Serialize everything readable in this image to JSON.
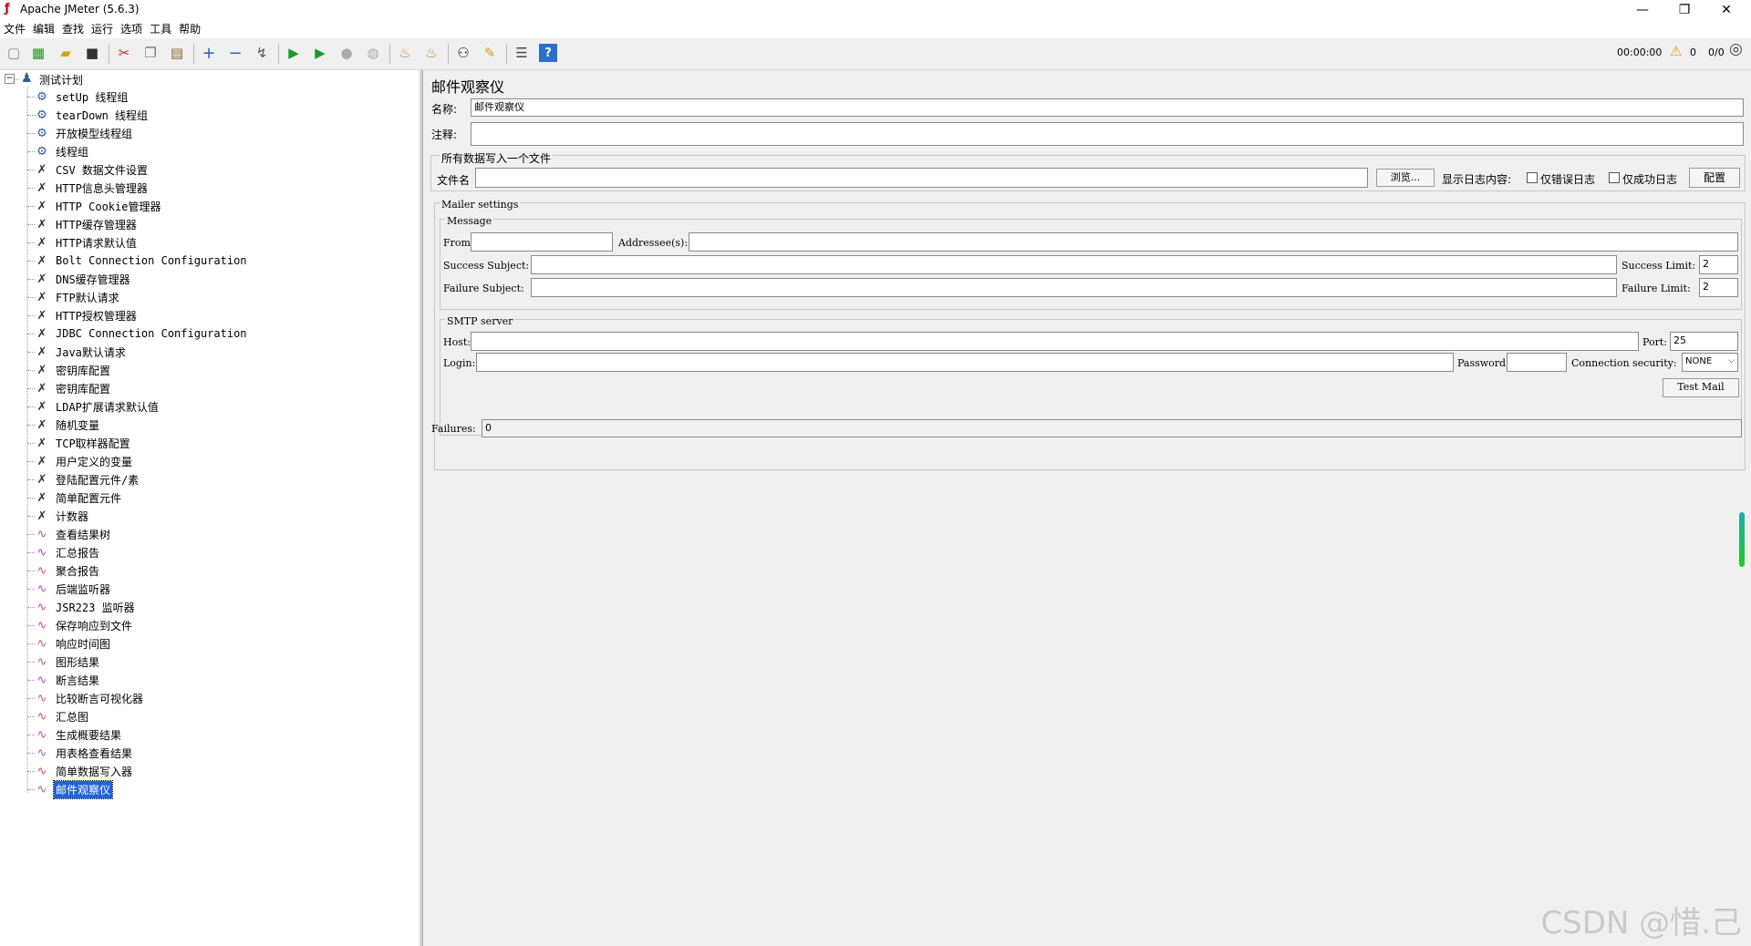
{
  "window": {
    "title": "Apache JMeter (5.6.3)",
    "min": "—",
    "max": "❐",
    "close": "✕"
  },
  "menu": [
    "文件",
    "编辑",
    "查找",
    "运行",
    "选项",
    "工具",
    "帮助"
  ],
  "toolbar": {
    "icons": [
      "new-icon",
      "templates-icon",
      "open-icon",
      "save-icon",
      "cut-icon",
      "copy-icon",
      "paste-icon",
      "expand-icon",
      "collapse-icon",
      "toggle-icon",
      "start-icon",
      "start-no-pause-icon",
      "stop-icon",
      "shutdown-icon",
      "clear-icon",
      "clear-all-icon",
      "search-icon",
      "reset-search-icon",
      "function-helper-icon",
      "help-icon"
    ],
    "timer": "00:00:00",
    "warn_count": "0",
    "threads": "0/0"
  },
  "tree": {
    "root": "测试计划",
    "nodes": [
      {
        "label": "setUp 线程组",
        "icon": "gear"
      },
      {
        "label": "tearDown 线程组",
        "icon": "gear"
      },
      {
        "label": "开放模型线程组",
        "icon": "gear"
      },
      {
        "label": "线程组",
        "icon": "gear"
      },
      {
        "label": "CSV 数据文件设置",
        "icon": "tool"
      },
      {
        "label": "HTTP信息头管理器",
        "icon": "tool"
      },
      {
        "label": "HTTP Cookie管理器",
        "icon": "tool"
      },
      {
        "label": "HTTP缓存管理器",
        "icon": "tool"
      },
      {
        "label": "HTTP请求默认值",
        "icon": "tool"
      },
      {
        "label": "Bolt Connection Configuration",
        "icon": "tool"
      },
      {
        "label": "DNS缓存管理器",
        "icon": "tool"
      },
      {
        "label": "FTP默认请求",
        "icon": "tool"
      },
      {
        "label": "HTTP授权管理器",
        "icon": "tool"
      },
      {
        "label": "JDBC Connection Configuration",
        "icon": "tool"
      },
      {
        "label": "Java默认请求",
        "icon": "tool"
      },
      {
        "label": "密钥库配置",
        "icon": "tool"
      },
      {
        "label": "密钥库配置",
        "icon": "tool"
      },
      {
        "label": "LDAP扩展请求默认值",
        "icon": "tool"
      },
      {
        "label": "随机变量",
        "icon": "tool"
      },
      {
        "label": "TCP取样器配置",
        "icon": "tool"
      },
      {
        "label": "用户定义的变量",
        "icon": "tool"
      },
      {
        "label": "登陆配置元件/素",
        "icon": "tool"
      },
      {
        "label": "简单配置元件",
        "icon": "tool"
      },
      {
        "label": "计数器",
        "icon": "tool"
      },
      {
        "label": "查看结果树",
        "icon": "chart"
      },
      {
        "label": "汇总报告",
        "icon": "chart"
      },
      {
        "label": "聚合报告",
        "icon": "chart"
      },
      {
        "label": "后端监听器",
        "icon": "chart"
      },
      {
        "label": "JSR223 监听器",
        "icon": "chart"
      },
      {
        "label": "保存响应到文件",
        "icon": "chart"
      },
      {
        "label": "响应时间图",
        "icon": "chart"
      },
      {
        "label": "图形结果",
        "icon": "chart"
      },
      {
        "label": "断言结果",
        "icon": "chart"
      },
      {
        "label": "比较断言可视化器",
        "icon": "chart"
      },
      {
        "label": "汇总图",
        "icon": "chart"
      },
      {
        "label": "生成概要结果",
        "icon": "chart"
      },
      {
        "label": "用表格查看结果",
        "icon": "chart"
      },
      {
        "label": "简单数据写入器",
        "icon": "chart"
      },
      {
        "label": "邮件观察仪",
        "icon": "chart",
        "selected": true
      }
    ]
  },
  "panel": {
    "heading": "邮件观察仪",
    "name_label": "名称:",
    "name_value": "邮件观察仪",
    "comment_label": "注释:",
    "comment_value": "",
    "file_group": "所有数据写入一个文件",
    "filename_label": "文件名",
    "filename_value": "",
    "browse": "浏览...",
    "log_content_label": "显示日志内容:",
    "errors_only": "仅错误日志",
    "success_only": "仅成功日志",
    "configure": "配置",
    "mailer_settings": "Mailer settings",
    "message": "Message",
    "from_label": "From:",
    "from_value": "",
    "addressees_label": "Addressee(s):",
    "addressees_value": "",
    "success_subject_label": "Success Subject:",
    "success_subject_value": "",
    "success_limit_label": "Success Limit:",
    "success_limit_value": "2",
    "failure_subject_label": "Failure Subject:",
    "failure_subject_value": "",
    "failure_limit_label": "Failure Limit:",
    "failure_limit_value": "2",
    "smtp_server": "SMTP server",
    "host_label": "Host:",
    "host_value": "",
    "port_label": "Port:",
    "port_value": "25",
    "login_label": "Login:",
    "login_value": "",
    "password_label": "Password:",
    "password_value": "",
    "security_label": "Connection security:",
    "security_value": "NONE",
    "test_mail": "Test Mail",
    "failures_label": "Failures:",
    "failures_value": "0"
  },
  "watermark": "CSDN @惜.己"
}
